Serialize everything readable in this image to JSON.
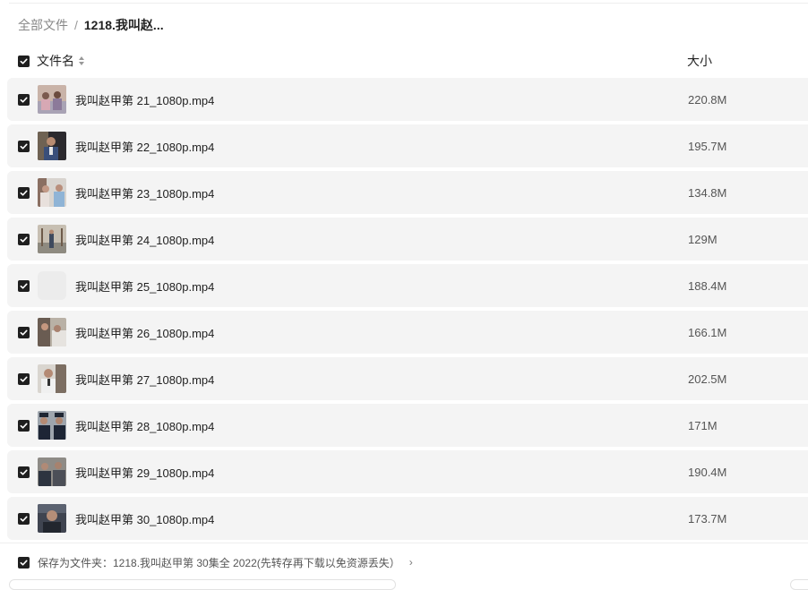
{
  "breadcrumb": {
    "root": "全部文件",
    "separator": "/",
    "current": "1218.我叫赵..."
  },
  "header": {
    "name_col": "文件名",
    "size_col": "大小",
    "sort_icon": "sort-updown-icon"
  },
  "files": [
    {
      "name": "我叫赵甲第 21_1080p.mp4",
      "size": "220.8M",
      "checked": true
    },
    {
      "name": "我叫赵甲第 22_1080p.mp4",
      "size": "195.7M",
      "checked": true
    },
    {
      "name": "我叫赵甲第 23_1080p.mp4",
      "size": "134.8M",
      "checked": true
    },
    {
      "name": "我叫赵甲第 24_1080p.mp4",
      "size": "129M",
      "checked": true
    },
    {
      "name": "我叫赵甲第 25_1080p.mp4",
      "size": "188.4M",
      "checked": true
    },
    {
      "name": "我叫赵甲第 26_1080p.mp4",
      "size": "166.1M",
      "checked": true
    },
    {
      "name": "我叫赵甲第 27_1080p.mp4",
      "size": "202.5M",
      "checked": true
    },
    {
      "name": "我叫赵甲第 28_1080p.mp4",
      "size": "171M",
      "checked": true
    },
    {
      "name": "我叫赵甲第 29_1080p.mp4",
      "size": "190.4M",
      "checked": true
    },
    {
      "name": "我叫赵甲第 30_1080p.mp4",
      "size": "173.7M",
      "checked": true
    }
  ],
  "footer": {
    "save_label": "保存为文件夹：1218.我叫赵甲第 30集全 2022(先转存再下载以免资源丢失）",
    "chevron": "›"
  },
  "colors": {
    "checkbox": "#1f1f1f",
    "row_bg": "#f4f4f4"
  }
}
